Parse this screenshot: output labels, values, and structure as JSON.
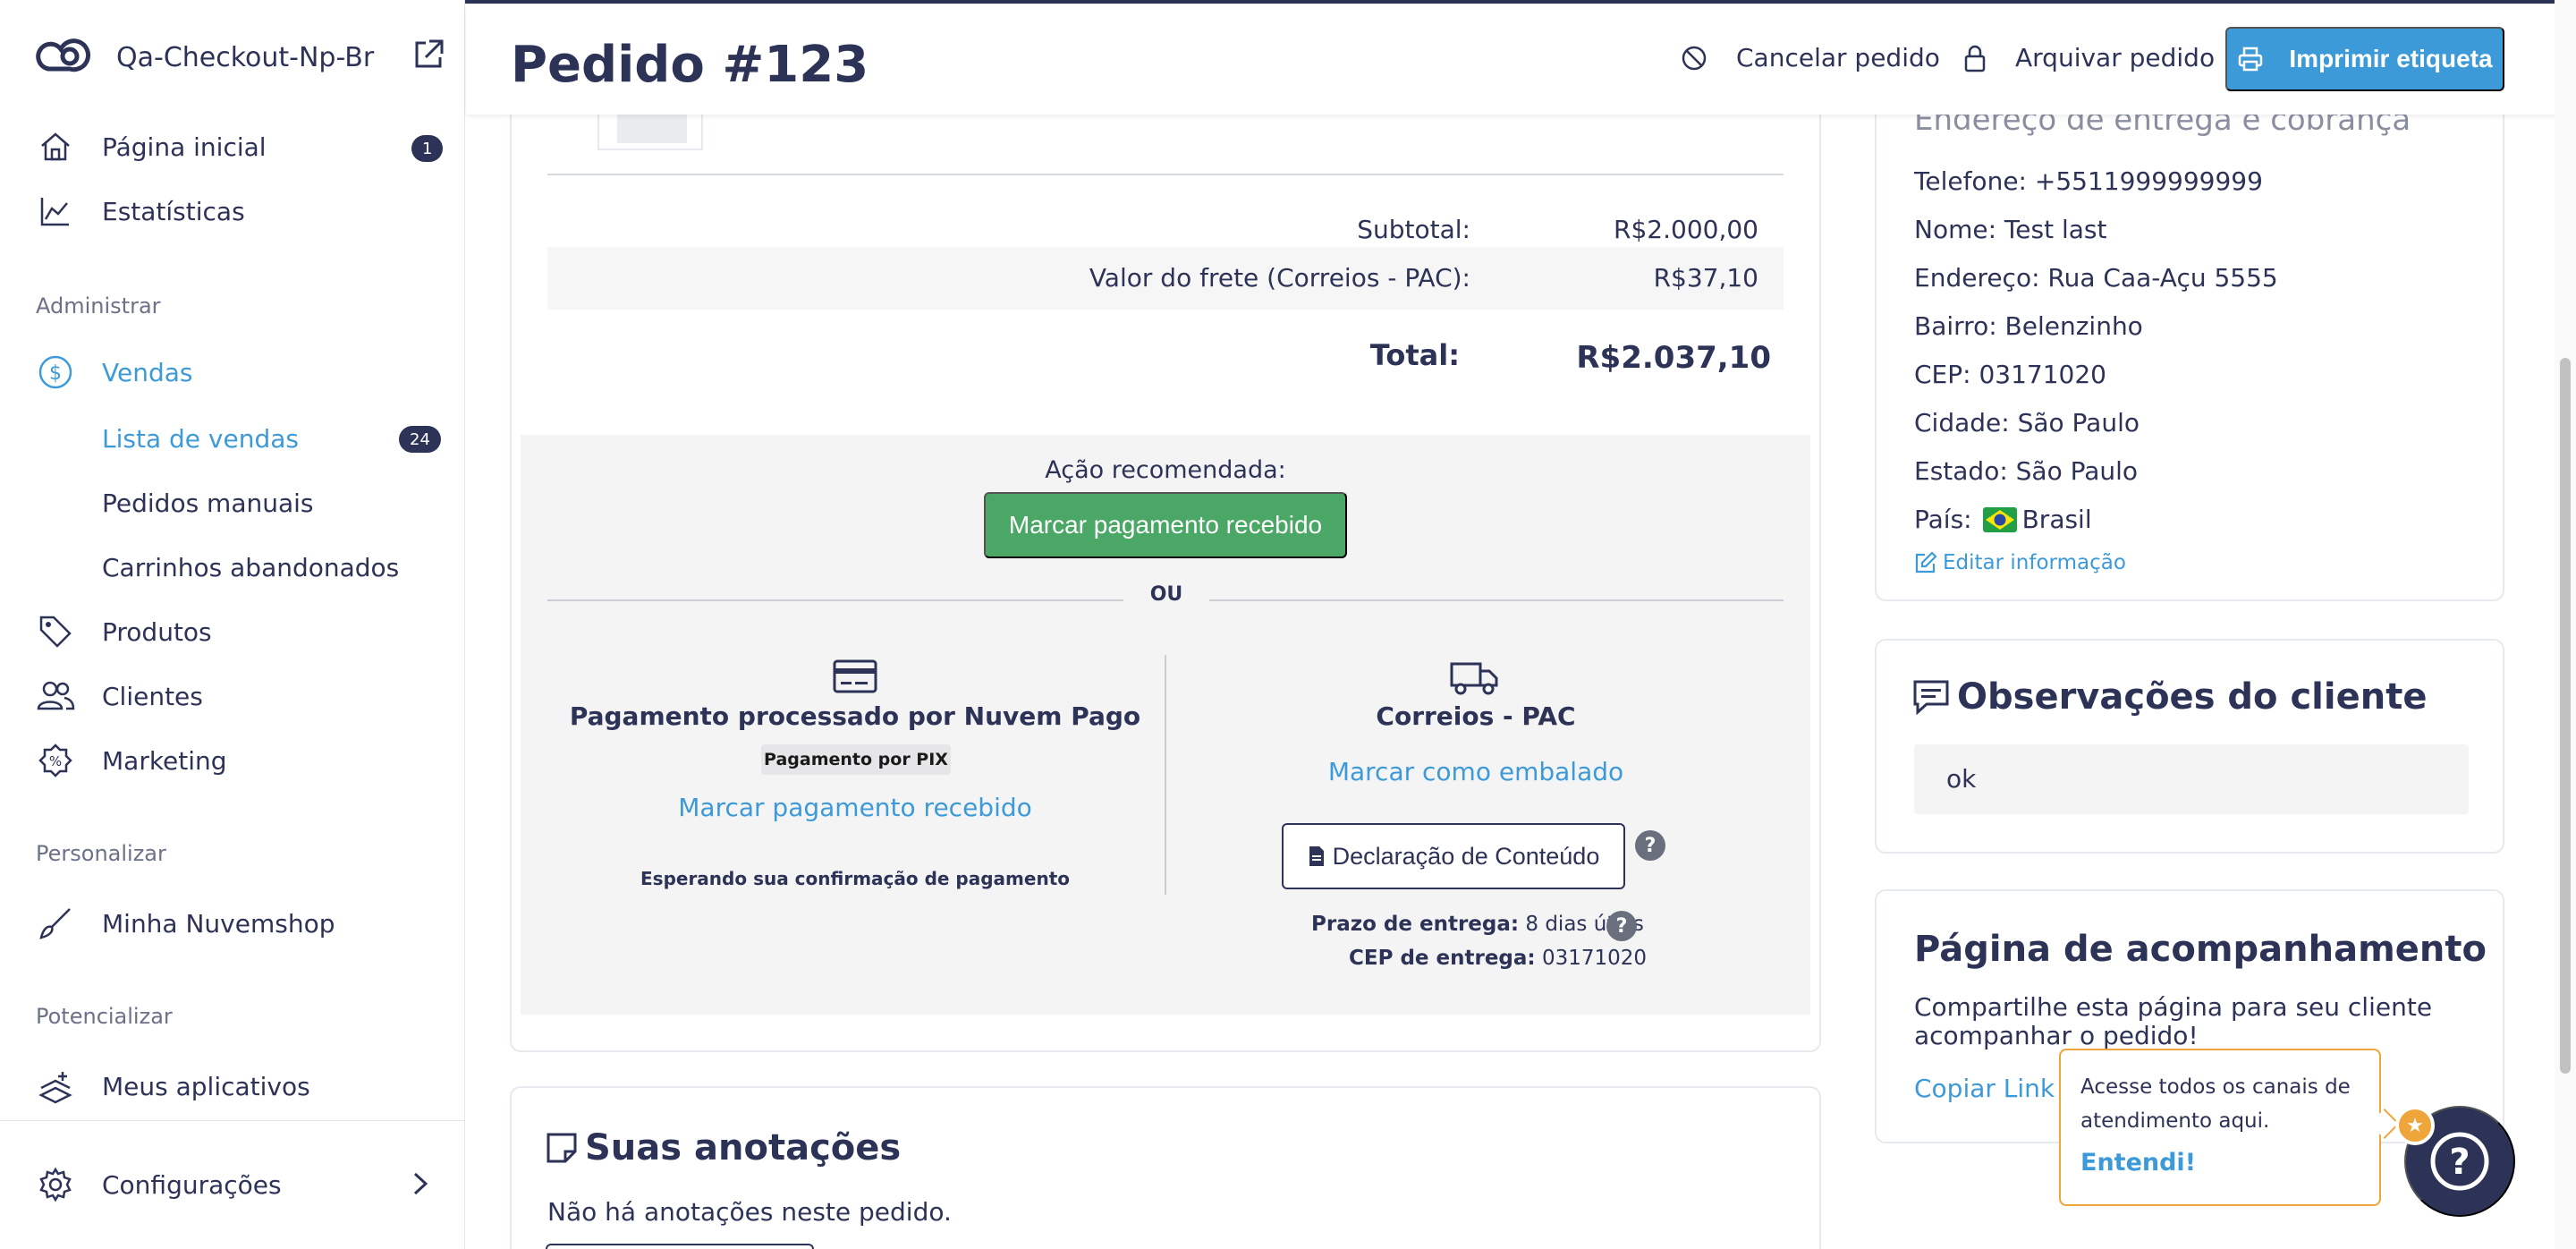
{
  "app": {
    "store_name": "Qa-Checkout-Np-Br"
  },
  "sidebar": {
    "home": {
      "label": "Página inicial",
      "badge": "1"
    },
    "stats": {
      "label": "Estatísticas"
    },
    "section_admin": "Administrar",
    "sales": {
      "label": "Vendas"
    },
    "sales_list": {
      "label": "Lista de vendas",
      "badge": "24"
    },
    "manual_orders": {
      "label": "Pedidos manuais"
    },
    "abandoned_carts": {
      "label": "Carrinhos abandonados"
    },
    "products": {
      "label": "Produtos"
    },
    "customers": {
      "label": "Clientes"
    },
    "marketing": {
      "label": "Marketing"
    },
    "section_customize": "Personalizar",
    "my_store": {
      "label": "Minha Nuvemshop"
    },
    "section_boost": "Potencializar",
    "my_apps": {
      "label": "Meus aplicativos"
    },
    "settings": {
      "label": "Configurações"
    }
  },
  "header": {
    "title": "Pedido #123",
    "cancel_label": "Cancelar pedido",
    "archive_label": "Arquivar pedido",
    "print_label": "Imprimir etiqueta"
  },
  "order": {
    "subtotal_label": "Subtotal:",
    "subtotal_value": "R$2.000,00",
    "shipping_label": "Valor do frete (Correios - PAC):",
    "shipping_value": "R$37,10",
    "total_label": "Total:",
    "total_value": "R$2.037,10",
    "recommended_label": "Ação recomendada:",
    "mark_paid_button": "Marcar pagamento recebido",
    "or_label": "OU",
    "payment_title": "Pagamento processado por Nuvem Pago",
    "payment_method": "Pagamento por PIX",
    "payment_link": "Marcar pagamento recebido",
    "payment_status": "Esperando sua confirmação de pagamento",
    "shipping_title": "Correios - PAC",
    "packed_link": "Marcar como embalado",
    "declaration_button": "Declaração de Conteúdo",
    "delivery_time_label": "Prazo de entrega:",
    "delivery_time_value": "8 dias úteis",
    "delivery_cep_label": "CEP de entrega:",
    "delivery_cep_value": "03171020"
  },
  "address": {
    "title": "Endereço de entrega e cobrança",
    "phone": "Telefone: +5511999999999",
    "name": "Nome: Test last",
    "street": "Endereço: Rua Caa-Açu 5555",
    "district": "Bairro: Belenzinho",
    "cep": "CEP: 03171020",
    "city": "Cidade: São Paulo",
    "state": "Estado: São Paulo",
    "country_label": "País:",
    "country_value": "Brasil",
    "edit_link": "Editar informação"
  },
  "observations": {
    "title": "Observações do cliente",
    "text": "ok"
  },
  "tracking": {
    "title": "Página de acompanhamento",
    "description": "Compartilhe esta página para seu cliente acompanhar o pedido!",
    "copy_link": "Copiar Link"
  },
  "notes": {
    "title": "Suas anotações",
    "empty_text": "Não há anotações neste pedido."
  },
  "tooltip": {
    "text": "Acesse todos os canais de atendimento aqui.",
    "action": "Entendi!"
  },
  "colors": {
    "primary": "#3d9ad8",
    "dark": "#2c3357",
    "success": "#4aa765",
    "warning": "#f0a53a"
  },
  "icons": [
    "logo-icon",
    "external-link-icon",
    "home-icon",
    "stats-icon",
    "dollar-icon",
    "tag-icon",
    "users-icon",
    "percent-icon",
    "brush-icon",
    "apps-icon",
    "gear-icon",
    "chevron-right-icon",
    "ban-icon",
    "lock-icon",
    "printer-icon",
    "credit-card-icon",
    "truck-icon",
    "document-icon",
    "question-icon",
    "edit-icon",
    "chat-icon",
    "note-icon",
    "copy-icon",
    "star-icon",
    "help-icon"
  ]
}
